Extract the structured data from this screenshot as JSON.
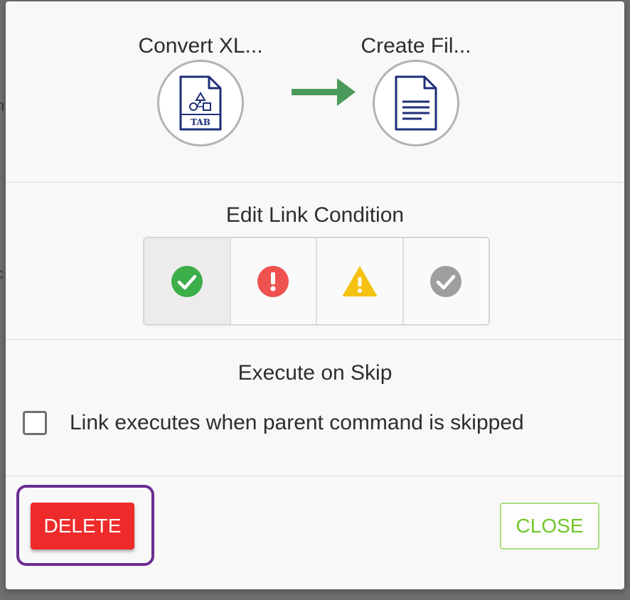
{
  "backdrop": {
    "fragments": [
      "n",
      "c",
      ","
    ]
  },
  "commands": {
    "source": {
      "label": "Convert XL...",
      "icon": "tab-file-icon",
      "icon_text": "TAB"
    },
    "target": {
      "label": "Create Fil...",
      "icon": "document-icon"
    },
    "arrow_color": "#4a9a5a"
  },
  "link_condition": {
    "title": "Edit Link Condition",
    "options": [
      {
        "name": "success",
        "icon": "check-circle-icon",
        "color": "#3cae4a",
        "selected": true
      },
      {
        "name": "error",
        "icon": "exclamation-circle-icon",
        "color": "#ef5350",
        "selected": false
      },
      {
        "name": "warning",
        "icon": "warning-triangle-icon",
        "color": "#f5c211",
        "selected": false
      },
      {
        "name": "any",
        "icon": "check-circle-icon",
        "color": "#9e9e9e",
        "selected": false
      }
    ]
  },
  "execute_on_skip": {
    "title": "Execute on Skip",
    "checkbox_label": "Link executes when parent command is skipped",
    "checked": false
  },
  "footer": {
    "delete_label": "DELETE",
    "close_label": "CLOSE",
    "delete_color": "#ee2a2a",
    "close_color": "#72c72a",
    "highlight_color": "#6b2c91"
  }
}
